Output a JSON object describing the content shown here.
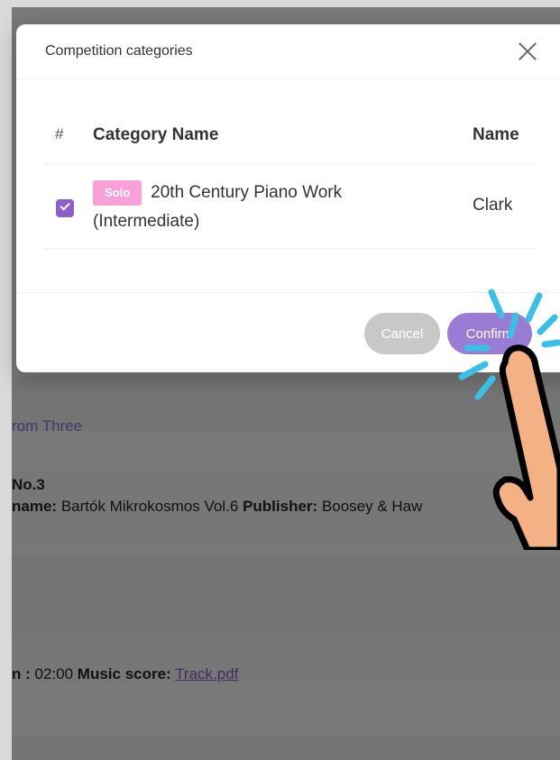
{
  "background": {
    "link_text": "rom Three",
    "piece_number": "No.3",
    "book_label": "name:",
    "book_value": "Bartók Mikrokosmos Vol.6",
    "publisher_label": "Publisher:",
    "publisher_value": "Boosey & Haw",
    "duration_label": "n :",
    "duration_value": "02:00",
    "score_label": "Music score:",
    "score_link": "Track.pdf"
  },
  "modal": {
    "title": "Competition categories",
    "table": {
      "headers": {
        "index": "#",
        "category": "Category Name",
        "name": "Name"
      },
      "rows": [
        {
          "checked": true,
          "badge": "Solo",
          "category": "20th Century Piano Work (Intermediate)",
          "name": "Clark"
        }
      ]
    },
    "buttons": {
      "cancel": "Cancel",
      "confirm": "Confirm"
    }
  },
  "icons": {
    "close": "close-icon",
    "check": "check-icon",
    "hand": "tap-hand-icon"
  },
  "colors": {
    "accent": "#9a7cd5",
    "checkbox": "#8b5fc7",
    "badge": "#f7a1d8",
    "cancel": "#c8c8c8",
    "tap_burst": "#3bbfe6",
    "hand_skin": "#f4b183"
  }
}
